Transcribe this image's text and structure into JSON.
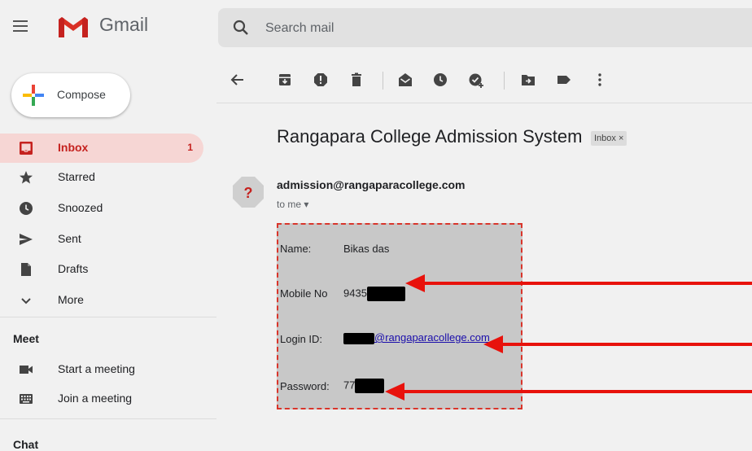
{
  "app": {
    "name": "Gmail"
  },
  "search": {
    "placeholder": "Search mail"
  },
  "compose": {
    "label": "Compose"
  },
  "sidebar": {
    "items": [
      {
        "label": "Inbox",
        "count": "1",
        "icon": "inbox-icon",
        "active": true
      },
      {
        "label": "Starred",
        "icon": "star-icon"
      },
      {
        "label": "Snoozed",
        "icon": "clock-icon"
      },
      {
        "label": "Sent",
        "icon": "send-icon"
      },
      {
        "label": "Drafts",
        "icon": "draft-icon"
      },
      {
        "label": "More",
        "icon": "chevron-down-icon"
      }
    ],
    "meet": {
      "title": "Meet",
      "items": [
        {
          "label": "Start a meeting",
          "icon": "video-icon"
        },
        {
          "label": "Join a meeting",
          "icon": "keyboard-icon"
        }
      ]
    },
    "chat": {
      "title": "Chat"
    }
  },
  "toolbar": {
    "icons": [
      "back-arrow-icon",
      "archive-icon",
      "report-spam-icon",
      "delete-icon",
      "mark-unread-icon",
      "snooze-icon",
      "add-to-tasks-icon",
      "move-to-icon",
      "label-icon",
      "more-vert-icon"
    ]
  },
  "message": {
    "subject": "Rangapara College Admission System",
    "label": "Inbox ×",
    "sender": "admission@rangaparacollege.com",
    "to": "to me ▾",
    "fields": [
      {
        "label": "Name:",
        "value": "Bikas das"
      },
      {
        "label": "Mobile No",
        "value": "9435"
      },
      {
        "label": "Login ID:",
        "value": "@rangaparacollege.com"
      },
      {
        "label": "Password:",
        "value": "77"
      }
    ]
  },
  "colors": {
    "accent_red": "#c5221f",
    "active_bg": "#f6d6d4",
    "annotation_red": "#e8120c",
    "body_bg": "#c8c8c8"
  }
}
